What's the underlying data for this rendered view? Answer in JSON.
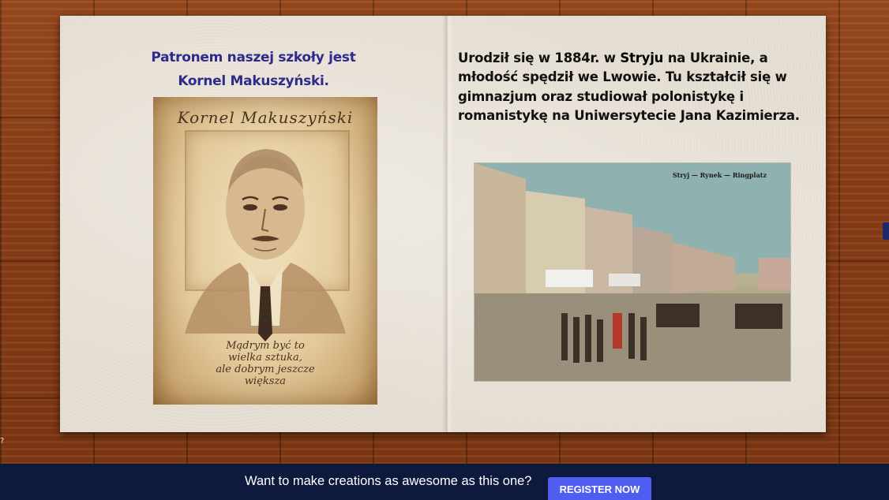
{
  "left_page": {
    "title_line1": "Patronem naszej szkoły jest",
    "title_line2": "Kornel Makuszyński.",
    "portrait": {
      "name": "Kornel Makuszyński",
      "motto": [
        "Mądrym być to",
        "wielka sztuka,",
        "ale dobrym jeszcze",
        "większa"
      ]
    }
  },
  "right_page": {
    "text_before": "Urodził się w  1884r. w ",
    "city": "Stryju",
    "text_after": " na Ukrainie, a młodość spędził we Lwowie. Tu kształcił się w gimnazjum  oraz studiował polonistykę i romanistykę na Uniwersytecie Jana Kazimierza.",
    "photo_caption": "Stryj — Rynek — Ringplatz"
  },
  "banner": {
    "text": "Want to make creations as awesome as this one?",
    "button_label": "REGISTER NOW"
  },
  "corner_mark": "?"
}
